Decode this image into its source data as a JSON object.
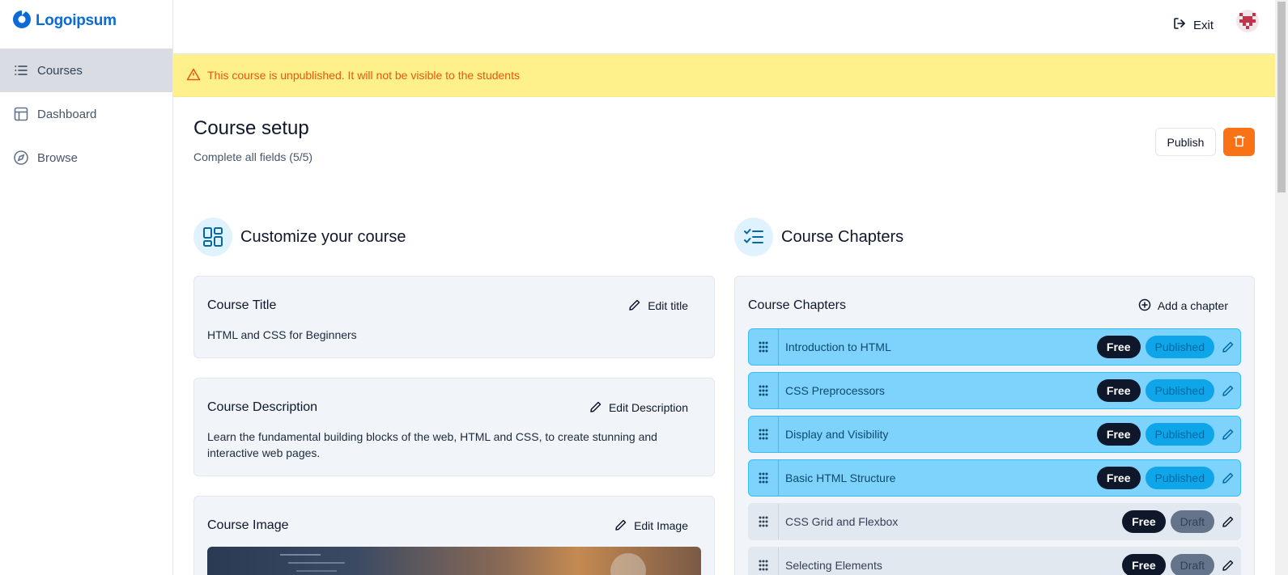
{
  "app": {
    "logo_text": "Logoipsum"
  },
  "sidebar": {
    "items": [
      {
        "label": "Courses",
        "icon": "list-icon",
        "active": true
      },
      {
        "label": "Dashboard",
        "icon": "layout-icon",
        "active": false
      },
      {
        "label": "Browse",
        "icon": "compass-icon",
        "active": false
      }
    ]
  },
  "topbar": {
    "exit_label": "Exit"
  },
  "banner": {
    "text": "This course is unpublished. It will not be visible to the students"
  },
  "header": {
    "title": "Course setup",
    "subtitle": "Complete all fields (5/5)",
    "publish_label": "Publish"
  },
  "customize": {
    "title": "Customize your course",
    "course_title": {
      "label": "Course Title",
      "edit_label": "Edit title",
      "value": "HTML and CSS for Beginners"
    },
    "course_description": {
      "label": "Course Description",
      "edit_label": "Edit Description",
      "value": "Learn the fundamental building blocks of the web, HTML and CSS, to create stunning and interactive web pages."
    },
    "course_image": {
      "label": "Course Image",
      "edit_label": "Edit Image"
    }
  },
  "chapters": {
    "section_title": "Course Chapters",
    "card_title": "Course Chapters",
    "add_label": "Add a chapter",
    "items": [
      {
        "title": "Introduction to HTML",
        "access": "Free",
        "status": "Published"
      },
      {
        "title": "CSS Preprocessors",
        "access": "Free",
        "status": "Published"
      },
      {
        "title": "Display and Visibility",
        "access": "Free",
        "status": "Published"
      },
      {
        "title": "Basic HTML Structure",
        "access": "Free",
        "status": "Published"
      },
      {
        "title": "CSS Grid and Flexbox",
        "access": "Free",
        "status": "Draft"
      },
      {
        "title": "Selecting Elements",
        "access": "Free",
        "status": "Draft"
      }
    ]
  },
  "colors": {
    "brand": "#0b6bd6",
    "warning_bg": "#fef08a",
    "warning_text": "#ea580c",
    "danger": "#f97316",
    "published_row": "#7dd3fc",
    "published_badge": "#0ea5e9",
    "draft_badge": "#64748b"
  }
}
